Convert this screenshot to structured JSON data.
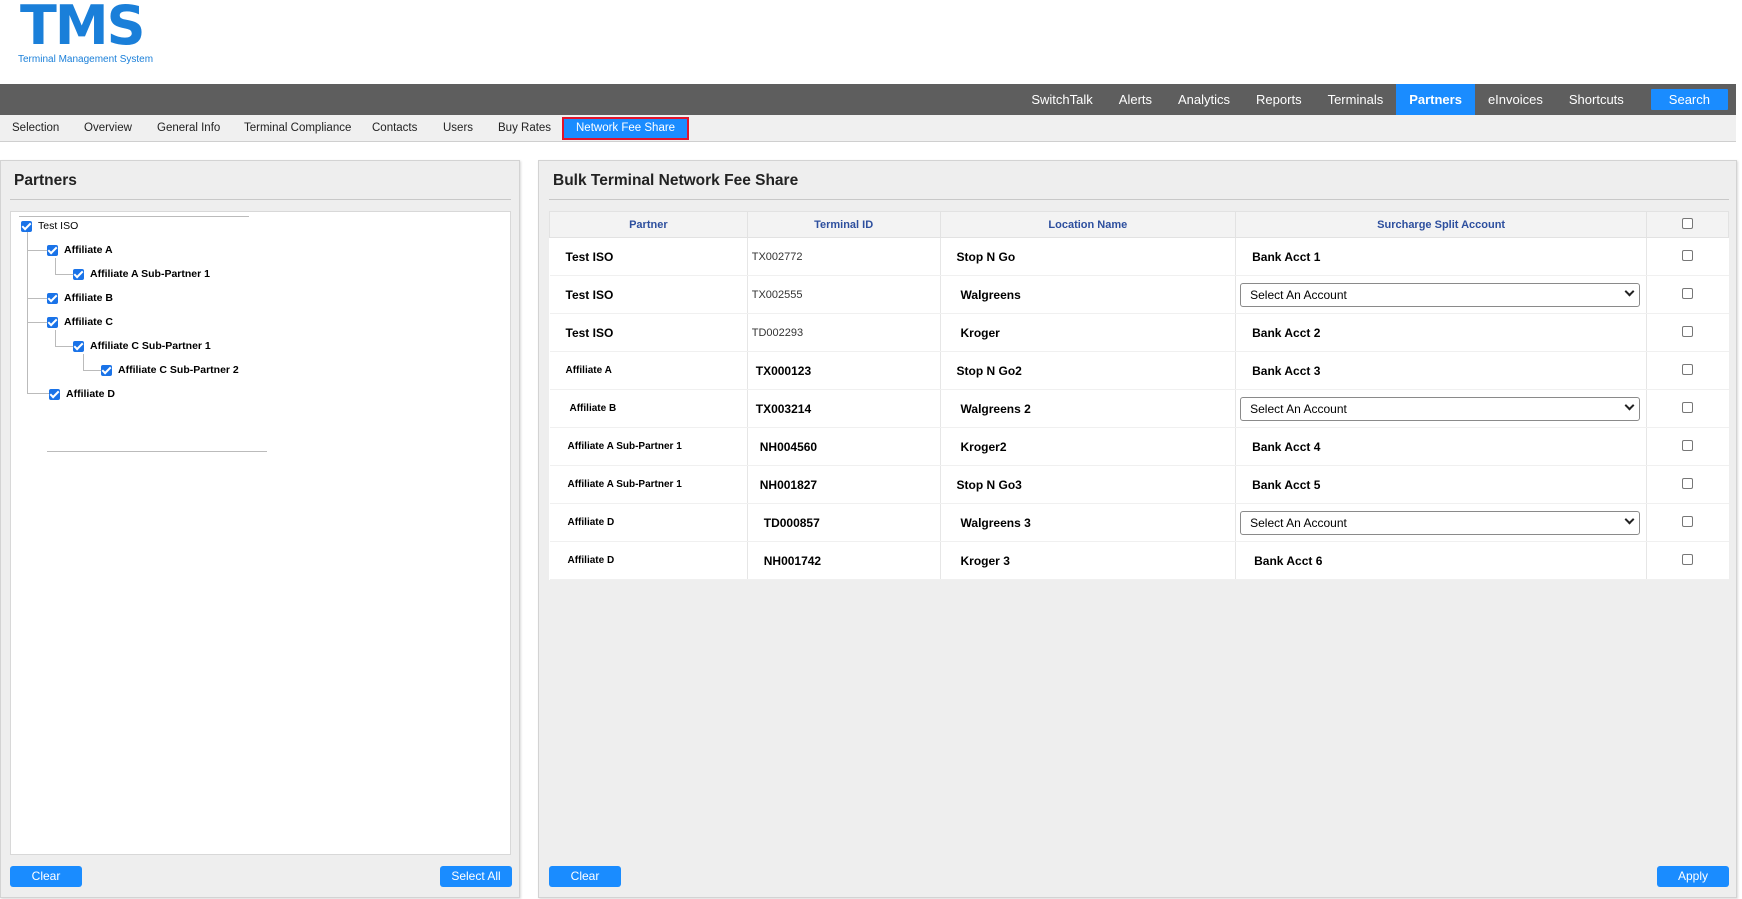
{
  "app": {
    "logo": "TMS",
    "subtitle": "Terminal Management System"
  },
  "topnav": {
    "items": [
      "SwitchTalk",
      "Alerts",
      "Analytics",
      "Reports",
      "Terminals",
      "Partners",
      "eInvoices",
      "Shortcuts"
    ],
    "active": "Partners",
    "search_label": "Search"
  },
  "subnav": {
    "tabs": [
      "Selection",
      "Overview",
      "General Info",
      "Terminal Compliance",
      "Contacts",
      "Users",
      "Buy Rates",
      "Network Fee Share"
    ],
    "active": "Network Fee Share"
  },
  "partners_panel": {
    "title": "Partners",
    "tree": [
      {
        "label": "Test ISO",
        "checked": true
      },
      {
        "label": "Affiliate A",
        "checked": true
      },
      {
        "label": "Affiliate A Sub-Partner 1",
        "checked": true
      },
      {
        "label": "Affiliate B",
        "checked": true
      },
      {
        "label": "Affiliate C",
        "checked": true
      },
      {
        "label": "Affiliate C Sub-Partner 1",
        "checked": true
      },
      {
        "label": "Affiliate C Sub-Partner 2",
        "checked": true
      },
      {
        "label": "Affiliate D",
        "checked": true
      }
    ],
    "clear_label": "Clear",
    "select_all_label": "Select All"
  },
  "fee_share_panel": {
    "title": "Bulk Terminal Network Fee Share",
    "columns": [
      "Partner",
      "Terminal ID",
      "Location Name",
      "Surcharge Split Account"
    ],
    "rows": [
      {
        "partner": "Test ISO",
        "terminal_id": "TX002772",
        "location": "Stop N Go",
        "account": "Bank Acct 1",
        "select": false
      },
      {
        "partner": "Test ISO",
        "terminal_id": "TX002555",
        "location": "Walgreens",
        "account": "Select An Account",
        "select": true
      },
      {
        "partner": "Test ISO",
        "terminal_id": "TD002293",
        "location": "Kroger",
        "account": "Bank Acct 2",
        "select": false
      },
      {
        "partner": "Affiliate A",
        "terminal_id": "TX000123",
        "location": "Stop N Go2",
        "account": "Bank Acct  3",
        "select": false
      },
      {
        "partner": "Affiliate B",
        "terminal_id": "TX003214",
        "location": "Walgreens 2",
        "account": "Select An Account",
        "select": true
      },
      {
        "partner": "Affiliate A Sub-Partner 1",
        "terminal_id": "NH004560",
        "location": "Kroger2",
        "account": "Bank Acct 4",
        "select": false
      },
      {
        "partner": "Affiliate A Sub-Partner 1",
        "terminal_id": "NH001827",
        "location": "Stop N Go3",
        "account": "Bank Acct  5",
        "select": false
      },
      {
        "partner": "Affiliate D",
        "terminal_id": "TD000857",
        "location": "Walgreens 3",
        "account": "Select An Account",
        "select": true
      },
      {
        "partner": "Affiliate D",
        "terminal_id": "NH001742",
        "location": "Kroger 3",
        "account": "Bank Acct  6",
        "select": false
      }
    ],
    "clear_label": "Clear",
    "apply_label": "Apply"
  },
  "colors": {
    "brand": "#1a7fd9",
    "accent": "#1a8cff",
    "topnav_bg": "#5e5e5e",
    "active_tab_border": "#e0142c",
    "header_text": "#2d4f9e"
  }
}
